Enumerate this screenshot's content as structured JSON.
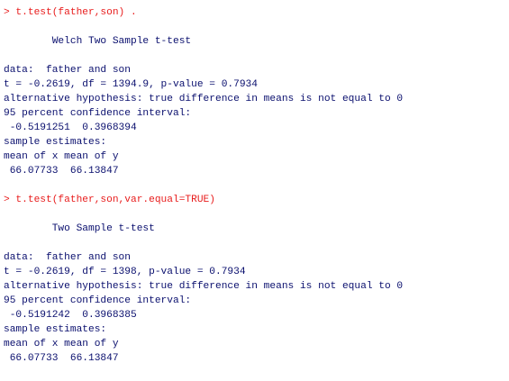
{
  "console": {
    "blocks": [
      {
        "command": "> t.test(father,son) .",
        "title": "        Welch Two Sample t-test",
        "data_line": "data:  father and son",
        "stat_line": "t = -0.2619, df = 1394.9, p-value = 0.7934",
        "alt_line": "alternative hypothesis: true difference in means is not equal to 0",
        "ci_label": "95 percent confidence interval:",
        "ci_values": " -0.5191251  0.3968394",
        "est_label": "sample estimates:",
        "est_header": "mean of x mean of y",
        "est_values": " 66.07733  66.13847"
      },
      {
        "command": "> t.test(father,son,var.equal=TRUE)",
        "title": "        Two Sample t-test",
        "data_line": "data:  father and son",
        "stat_line": "t = -0.2619, df = 1398, p-value = 0.7934",
        "alt_line": "alternative hypothesis: true difference in means is not equal to 0",
        "ci_label": "95 percent confidence interval:",
        "ci_values": " -0.5191242  0.3968385",
        "est_label": "sample estimates:",
        "est_header": "mean of x mean of y",
        "est_values": " 66.07733  66.13847"
      }
    ],
    "colors": {
      "command": "#e81c1c",
      "output": "#0a0f6e",
      "background": "#ffffff"
    }
  }
}
